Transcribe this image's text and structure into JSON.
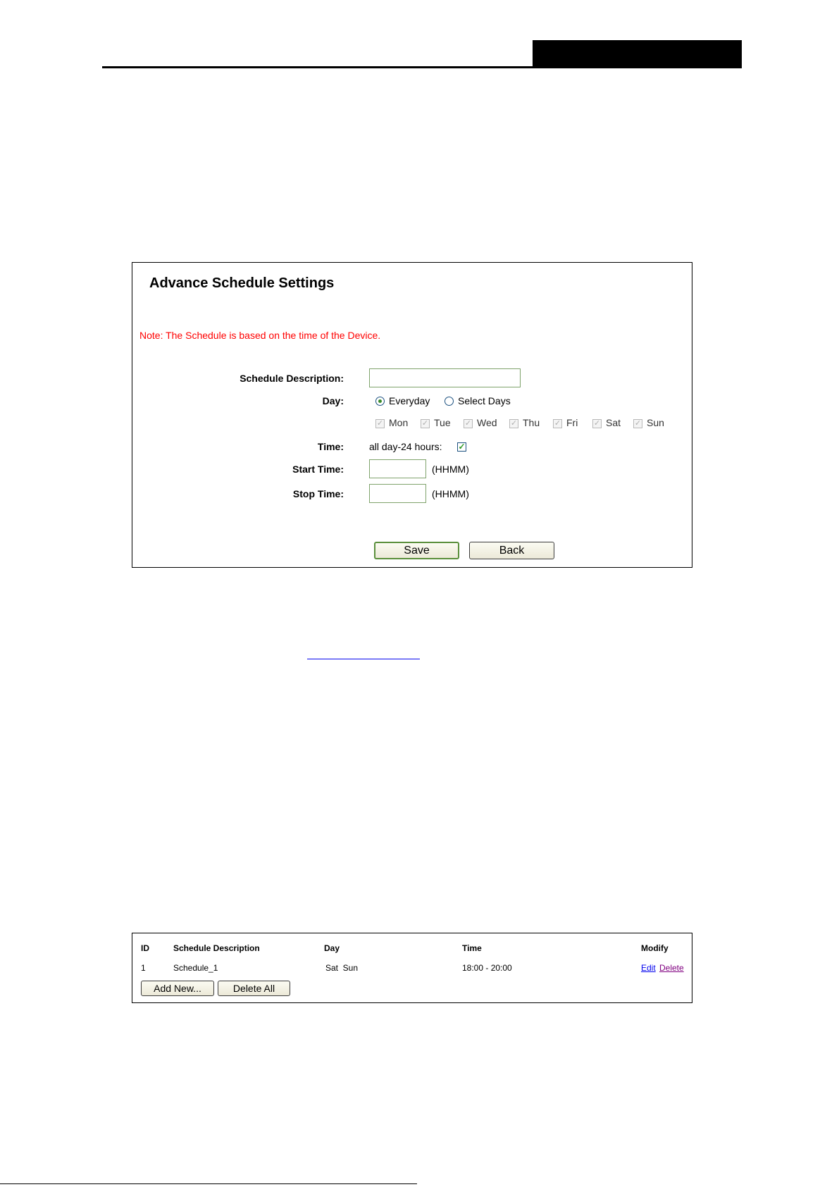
{
  "settings": {
    "title": "Advance Schedule Settings",
    "note": "Note: The Schedule is based on the time of the Device.",
    "description_label": "Schedule Description:",
    "description_value": "",
    "day_label": "Day:",
    "day_options": [
      "Everyday",
      "Select Days"
    ],
    "day_selected": "Everyday",
    "days": [
      "Mon",
      "Tue",
      "Wed",
      "Thu",
      "Fri",
      "Sat",
      "Sun"
    ],
    "time_label": "Time:",
    "all_day_label": "all day-24 hours:",
    "all_day_checked": true,
    "start_label": "Start Time:",
    "start_value": "",
    "start_unit": "(HHMM)",
    "stop_label": "Stop Time:",
    "stop_value": "",
    "stop_unit": "(HHMM)",
    "save_label": "Save",
    "back_label": "Back"
  },
  "schedule_list": {
    "columns": [
      "ID",
      "Schedule Description",
      "Day",
      "Time",
      "Modify"
    ],
    "rows": [
      {
        "id": "1",
        "description": "Schedule_1",
        "day": "Sat  Sun",
        "time": "18:00 - 20:00",
        "edit": "Edit",
        "delete": "Delete"
      }
    ],
    "add_new_label": "Add New...",
    "delete_all_label": "Delete All"
  },
  "colors": {
    "note": "#ff0000",
    "link_edit": "#0000ee",
    "link_delete": "#800080",
    "field_border": "#7fa36c"
  }
}
